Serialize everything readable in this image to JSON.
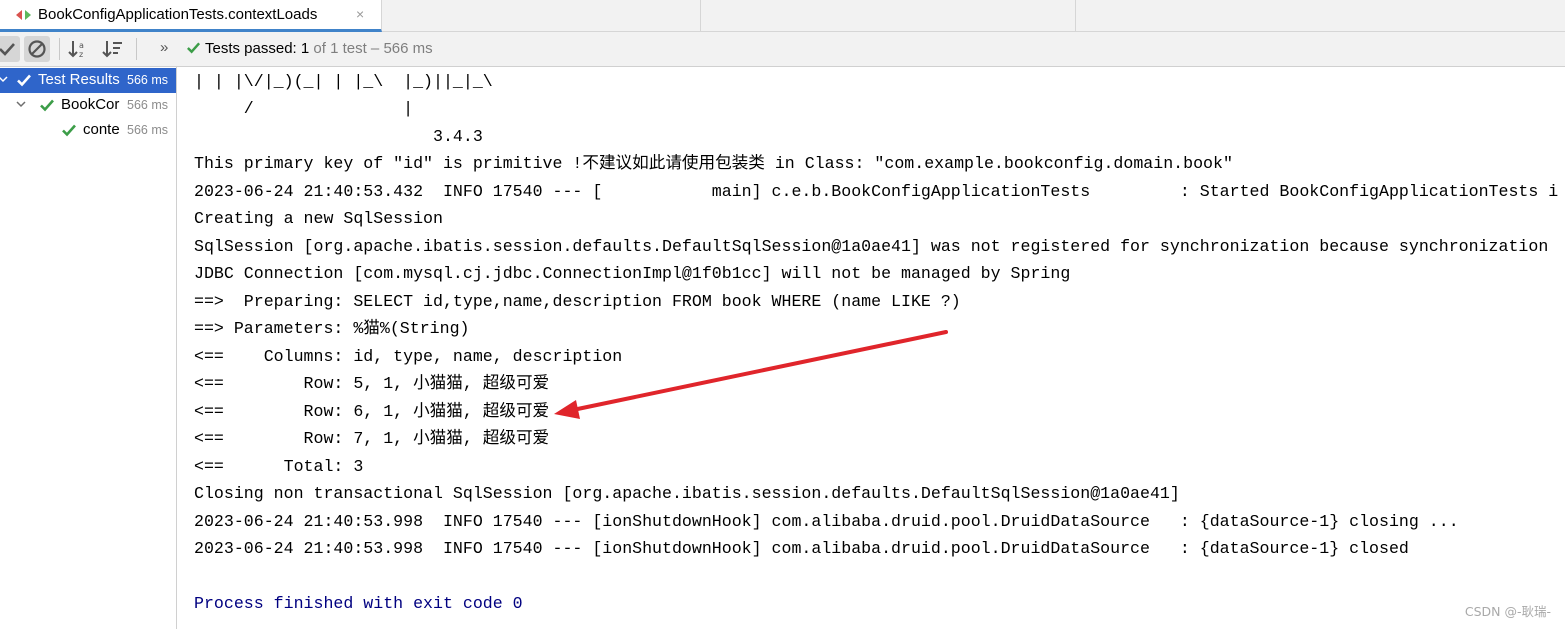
{
  "tab": {
    "title": "BookConfigApplicationTests.contextLoads",
    "close": "×"
  },
  "toolbar": {
    "status_label": "Tests passed: ",
    "status_count": "1",
    "status_rest": " of 1 test – 566 ms",
    "overflow": "»"
  },
  "tree": {
    "items": [
      {
        "name": "Test Results",
        "time": "566 ms"
      },
      {
        "name": "BookCor",
        "time": "566 ms"
      },
      {
        "name": "conte",
        "time": "566 ms"
      }
    ]
  },
  "console": {
    "lines": [
      "| | |\\/|_)(_| | |_\\  |_)||_|_\\",
      "     /               |",
      "                        3.4.3",
      "This primary key of \"id\" is primitive !不建议如此请使用包装类 in Class: \"com.example.bookconfig.domain.book\"",
      "2023-06-24 21:40:53.432  INFO 17540 --- [           main] c.e.b.BookConfigApplicationTests         : Started BookConfigApplicationTests i",
      "Creating a new SqlSession",
      "SqlSession [org.apache.ibatis.session.defaults.DefaultSqlSession@1a0ae41] was not registered for synchronization because synchronization",
      "JDBC Connection [com.mysql.cj.jdbc.ConnectionImpl@1f0b1cc] will not be managed by Spring",
      "==>  Preparing: SELECT id,type,name,description FROM book WHERE (name LIKE ?)",
      "==> Parameters: %猫%(String)",
      "<==    Columns: id, type, name, description",
      "<==        Row: 5, 1, 小猫猫, 超级可爱",
      "<==        Row: 6, 1, 小猫猫, 超级可爱",
      "<==        Row: 7, 1, 小猫猫, 超级可爱",
      "<==      Total: 3",
      "Closing non transactional SqlSession [org.apache.ibatis.session.defaults.DefaultSqlSession@1a0ae41]",
      "2023-06-24 21:40:53.998  INFO 17540 --- [ionShutdownHook] com.alibaba.druid.pool.DruidDataSource   : {dataSource-1} closing ...",
      "2023-06-24 21:40:53.998  INFO 17540 --- [ionShutdownHook] com.alibaba.druid.pool.DruidDataSource   : {dataSource-1} closed",
      "",
      "Process finished with exit code 0"
    ]
  },
  "annotation_color": "#e0252b",
  "watermark": "CSDN @-耿瑞-"
}
